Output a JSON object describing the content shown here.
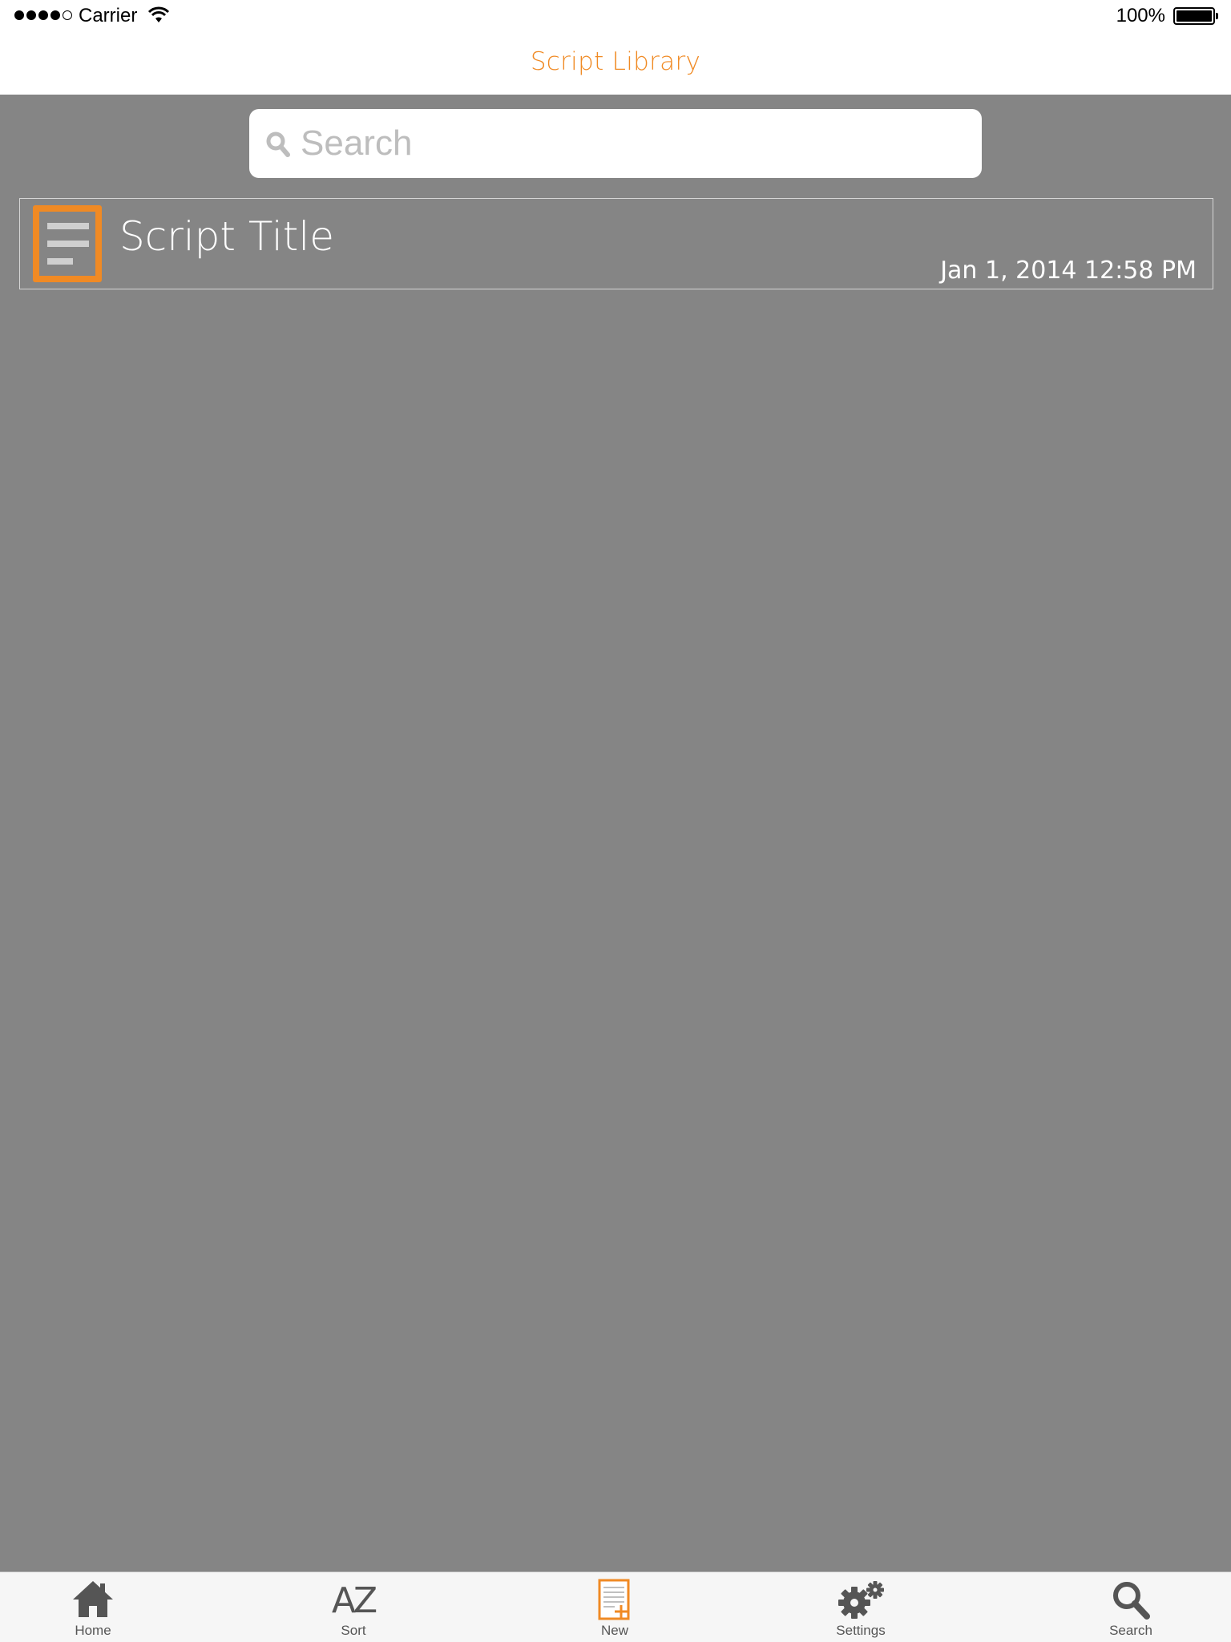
{
  "status_bar": {
    "carrier": "Carrier",
    "battery_percent": "100%",
    "signal_bars": 4,
    "signal_max": 5
  },
  "nav": {
    "title": "Script Library"
  },
  "search": {
    "placeholder": "Search",
    "value": ""
  },
  "scripts": [
    {
      "title": "Script Title",
      "date": "Jan 1, 2014 12:58 PM"
    }
  ],
  "tab_bar": {
    "tabs": [
      {
        "label": "Home",
        "icon": "home-icon"
      },
      {
        "label": "Sort",
        "icon": "az-sort-icon",
        "glyph": "AZ"
      },
      {
        "label": "New",
        "icon": "new-document-icon"
      },
      {
        "label": "Settings",
        "icon": "gears-icon"
      },
      {
        "label": "Search",
        "icon": "magnifier-icon"
      }
    ]
  },
  "colors": {
    "accent": "#f08a24",
    "content_bg": "#858585",
    "tab_icon": "#555555"
  }
}
